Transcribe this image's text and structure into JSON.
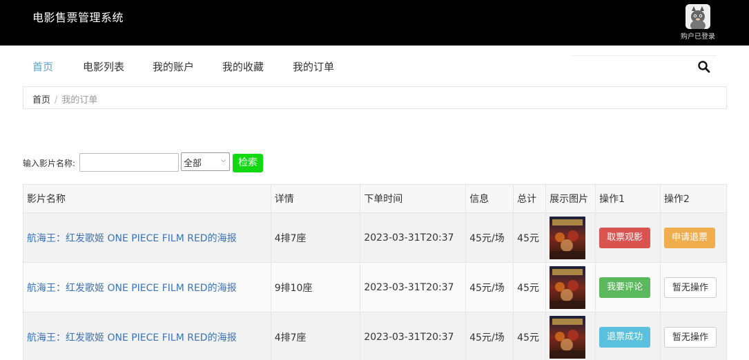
{
  "header": {
    "brand": "电影售票管理系统",
    "user_label": "购户已登录",
    "avatar_icon": "cat-avatar-icon"
  },
  "nav": {
    "items": [
      "首页",
      "电影列表",
      "我的账户",
      "我的收藏",
      "我的订单"
    ],
    "active_index": 0,
    "search_placeholder": "",
    "search_icon": "search-icon"
  },
  "breadcrumb": {
    "home": "首页",
    "separator": "/",
    "current": "我的订单"
  },
  "filter": {
    "label": "输入影片名称:",
    "input_value": "",
    "select_value": "全部",
    "button_label": "检索"
  },
  "table": {
    "headers": [
      "影片名称",
      "详情",
      "下单时间",
      "信息",
      "总计",
      "展示图片",
      "操作1",
      "操作2"
    ],
    "rows": [
      {
        "name": "航海王：红发歌姬 ONE PIECE FILM RED的海报",
        "detail": "4排7座",
        "time": "2023-03-31T20:37",
        "info": "45元/场",
        "total": "45元",
        "op1": "取票观影",
        "op1_color": "#d9534f",
        "op2": "申请退票",
        "op2_color": "#f0ad4e"
      },
      {
        "name": "航海王：红发歌姬 ONE PIECE FILM RED的海报",
        "detail": "9排10座",
        "time": "2023-03-31T20:37",
        "info": "45元/场",
        "total": "45元",
        "op1": "我要评论",
        "op1_color": "#5cb85c",
        "op2": "暂无操作",
        "op2_color": "#ffffff"
      },
      {
        "name": "航海王：红发歌姬 ONE PIECE FILM RED的海报",
        "detail": "4排7座",
        "time": "2023-03-31T20:37",
        "info": "45元/场",
        "total": "45元",
        "op1": "退票成功",
        "op1_color": "#5bc0de",
        "op2": "暂无操作",
        "op2_color": "#ffffff"
      }
    ]
  }
}
